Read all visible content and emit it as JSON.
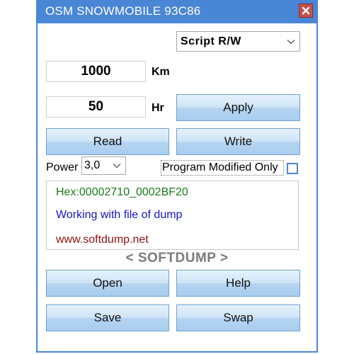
{
  "window": {
    "title": "OSM SNOWMOBILE 93C86"
  },
  "mode_select": {
    "value": "Script R/W"
  },
  "km": {
    "value": "1000",
    "unit": "Km"
  },
  "hr": {
    "value": "50",
    "unit": "Hr"
  },
  "buttons": {
    "apply": "Apply",
    "read": "Read",
    "write": "Write",
    "open": "Open",
    "help": "Help",
    "save": "Save",
    "swap": "Swap"
  },
  "power": {
    "label": "Power",
    "value": "3,0"
  },
  "program_modified": {
    "label": "Program Modified Only",
    "checked": false
  },
  "log": {
    "lines": [
      {
        "text": "Hex:00002710_0002BF20",
        "color": "#1a7a1a"
      },
      {
        "text": "Working with file of dump",
        "color": "#1515c8"
      },
      {
        "text": "www.softdump.net",
        "color": "#8b1212"
      }
    ]
  },
  "brand": "< SOFTDUMP >",
  "colors": {
    "titlebar": "#4a86d6",
    "close": "#c8504b",
    "checkbox_border": "#4a86d6"
  }
}
